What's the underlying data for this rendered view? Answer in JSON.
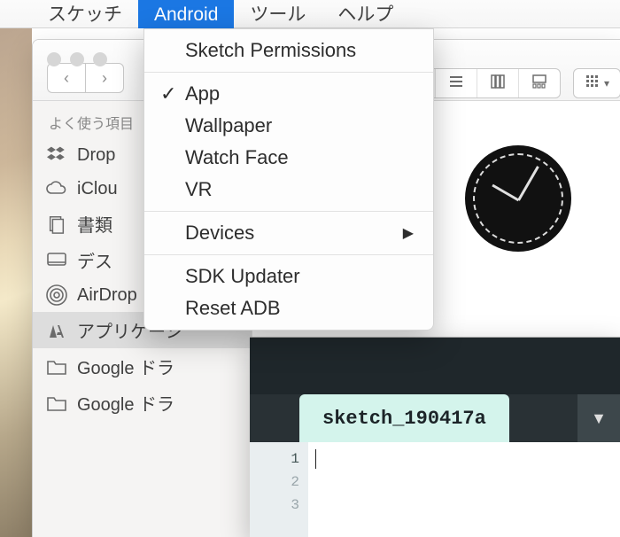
{
  "menubar": {
    "items": [
      {
        "label": "スケッチ",
        "selected": false
      },
      {
        "label": "Android",
        "selected": true
      },
      {
        "label": "ツール",
        "selected": false
      },
      {
        "label": "ヘルプ",
        "selected": false
      }
    ]
  },
  "dropdown": {
    "items": [
      {
        "label": "Sketch Permissions"
      },
      {
        "sep": true
      },
      {
        "label": "App",
        "checked": true
      },
      {
        "label": "Wallpaper"
      },
      {
        "label": "Watch Face"
      },
      {
        "label": "VR"
      },
      {
        "sep": true
      },
      {
        "label": "Devices",
        "submenu": true
      },
      {
        "sep": true
      },
      {
        "label": "SDK Updater"
      },
      {
        "label": "Reset ADB"
      }
    ]
  },
  "finder": {
    "nav": {
      "back_glyph": "‹",
      "fwd_glyph": "›"
    },
    "view": {
      "modes": [
        {
          "name": "icon-view",
          "active": true
        },
        {
          "name": "list-view"
        },
        {
          "name": "column-view"
        },
        {
          "name": "gallery-view"
        }
      ],
      "group_glyph": "☰",
      "dropdown_glyph": "▾"
    },
    "sidebar": {
      "title": "よく使う項目",
      "items": [
        {
          "icon": "dropbox-icon",
          "label": "Drop"
        },
        {
          "icon": "icloud-icon",
          "label": "iClou"
        },
        {
          "icon": "documents-icon",
          "label": "書類"
        },
        {
          "icon": "desktop-icon",
          "label": "デス"
        },
        {
          "icon": "airdrop-icon",
          "label": "AirDrop"
        },
        {
          "icon": "applications-icon",
          "label": "アプリケーシ",
          "active": true
        },
        {
          "icon": "folder-icon",
          "label": "Google ドラ"
        },
        {
          "icon": "folder-icon",
          "label": "Google ドラ"
        }
      ]
    }
  },
  "processing": {
    "tab": "sketch_190417a",
    "mode_glyph": "▼",
    "gutter": [
      "1",
      "2",
      "3"
    ]
  }
}
